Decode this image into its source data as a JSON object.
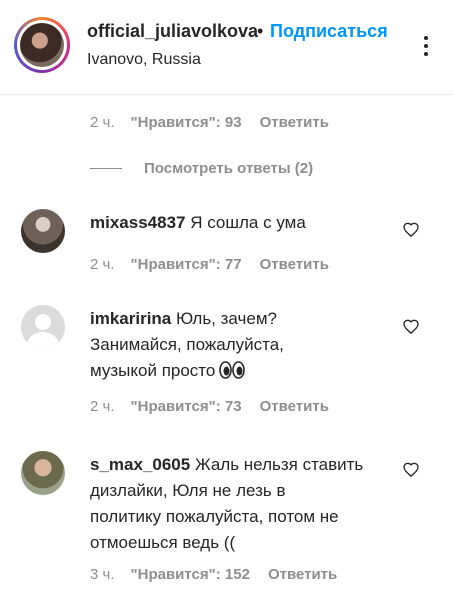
{
  "header": {
    "username": "official_juliavolkova",
    "separator": "•",
    "follow_label": "Подписаться",
    "location": "Ivanovo, Russia"
  },
  "top_comment_meta": {
    "time": "2 ч.",
    "likes": "\"Нравится\": 93",
    "reply": "Ответить"
  },
  "view_replies": "Посмотреть ответы (2)",
  "comments": [
    {
      "username": "mixass4837",
      "text": "Я сошла с ума",
      "time": "2 ч.",
      "likes": "\"Нравится\": 77",
      "reply": "Ответить"
    },
    {
      "username": "imkaririna",
      "text_line1": "Юль, зачем?",
      "text_line2": "Занимайся, пожалуйста,",
      "text_line3": "музыкой просто",
      "emoji": "eyes-emoji",
      "time": "2 ч.",
      "likes": "\"Нравится\": 73",
      "reply": "Ответить"
    },
    {
      "username": "s_max_0605",
      "text_line1": "Жаль нельзя ставить",
      "text_line2": "дизлайки, Юля не лезь в",
      "text_line3": "политику пожалуйста, потом не",
      "text_line4": "отмоешься ведь ((",
      "time": "3 ч.",
      "likes": "\"Нравится\": 152",
      "reply": "Ответить"
    }
  ]
}
